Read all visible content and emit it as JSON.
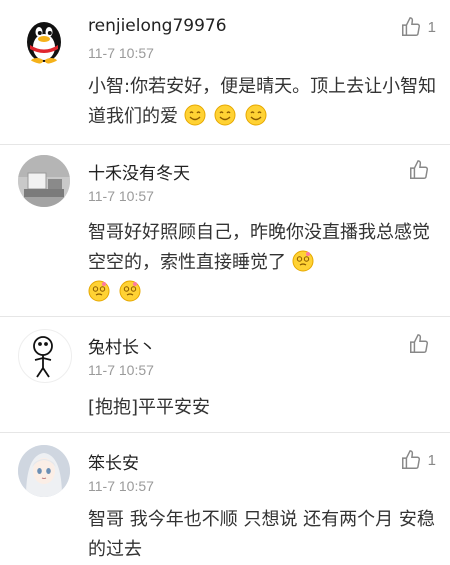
{
  "comments": [
    {
      "user": "renjielong79976",
      "time": "11-7 10:57",
      "text": "小智:你若安好，便是晴天。顶上去让小智知道我们的爱",
      "likes": "1",
      "emojis": [
        "smile-emoji",
        "smile-emoji",
        "smile-emoji"
      ]
    },
    {
      "user": "十禾没有冬天",
      "time": "11-7 10:57",
      "text": "智哥好好照顾自己，昨晚你没直播我总感觉空空的，索性直接睡觉了",
      "likes": "",
      "emojis": [
        "dizzy-emoji",
        "dizzy-emoji",
        "dizzy-emoji"
      ]
    },
    {
      "user": "兔村长丶",
      "time": "11-7 10:57",
      "text": "[抱抱]平平安安",
      "likes": ""
    },
    {
      "user": "笨长安",
      "time": "11-7 10:57",
      "text": "智哥 我今年也不顺 只想说 还有两个月 安稳的过去",
      "likes": "1"
    }
  ],
  "icons": {
    "like": "thumbs-up-icon",
    "avatar1": "qq-penguin-avatar",
    "avatar2": "room-photo-avatar",
    "avatar3": "stick-figure-avatar",
    "avatar4": "anime-girl-avatar"
  },
  "colors": {
    "name": "#222222",
    "time": "#9a9a9a",
    "text": "#333333",
    "icon": "#888888"
  }
}
